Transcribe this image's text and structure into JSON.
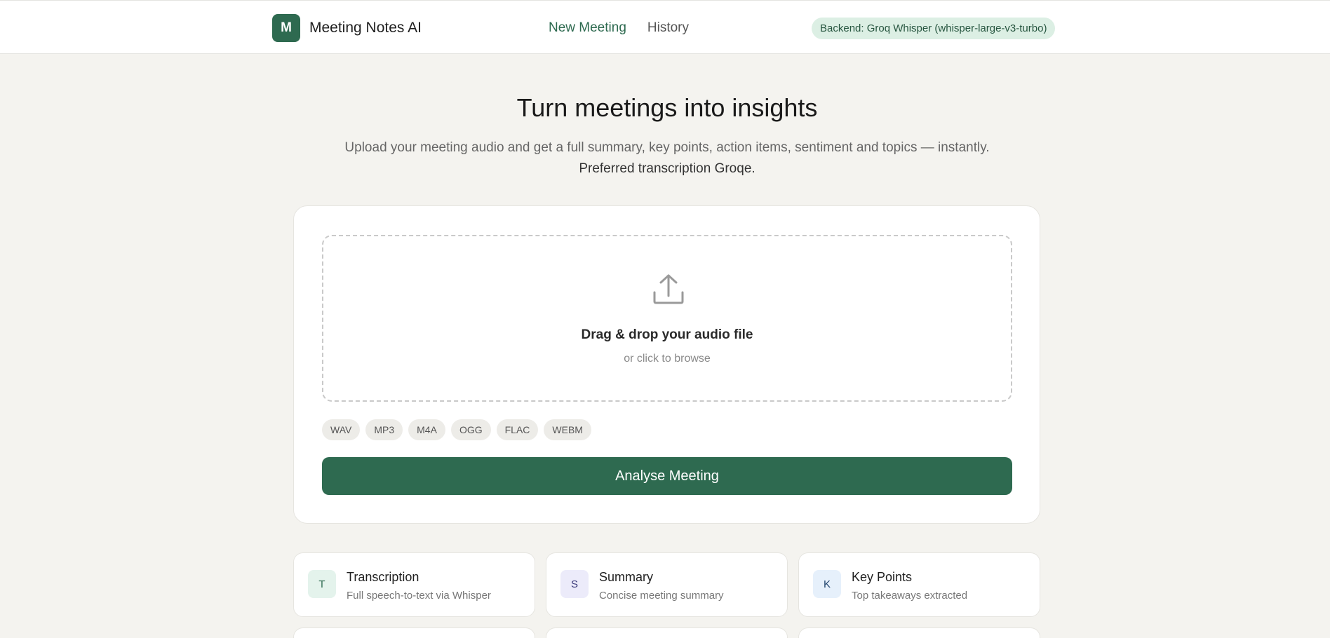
{
  "header": {
    "logo_letter": "M",
    "app_name": "Meeting Notes AI",
    "nav": [
      {
        "label": "New Meeting",
        "active": true
      },
      {
        "label": "History",
        "active": false
      }
    ],
    "backend_badge": "Backend: Groq Whisper (whisper-large-v3-turbo)"
  },
  "hero": {
    "title": "Turn meetings into insights",
    "subtitle": "Upload your meeting audio and get a full summary, key points, action items, sentiment and topics — instantly.",
    "subtitle_line2": "Preferred transcription Groqe."
  },
  "upload": {
    "icon": "upload-icon",
    "title": "Drag & drop your audio file",
    "subtitle": "or click to browse",
    "formats": [
      "WAV",
      "MP3",
      "M4A",
      "OGG",
      "FLAC",
      "WEBM"
    ],
    "button_label": "Analyse Meeting"
  },
  "features": [
    {
      "badge": "T",
      "title": "Transcription",
      "desc": "Full speech-to-text via Whisper",
      "badge_bg": "#e4f3ec",
      "badge_color": "#2e6a50"
    },
    {
      "badge": "S",
      "title": "Summary",
      "desc": "Concise meeting summary",
      "badge_bg": "#ecebfa",
      "badge_color": "#3b3a7a"
    },
    {
      "badge": "K",
      "title": "Key Points",
      "desc": "Top takeaways extracted",
      "badge_bg": "#e6f0fb",
      "badge_color": "#22456e"
    }
  ],
  "colors": {
    "accent": "#2e6a50",
    "page_bg": "#f4f3ef",
    "badge_bg": "#dcefe4"
  }
}
